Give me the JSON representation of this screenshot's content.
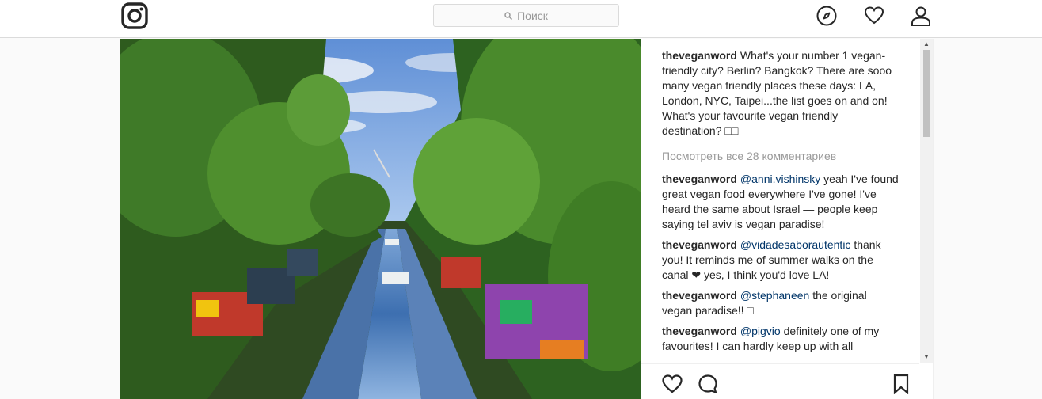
{
  "app": {
    "logo_icon": "instagram-logo-icon"
  },
  "search": {
    "placeholder": "Поиск",
    "icon": "search-icon"
  },
  "nav": {
    "explore_icon": "compass-icon",
    "activity_icon": "heart-icon",
    "profile_icon": "user-icon"
  },
  "post": {
    "image_description_icon": "canal-photo",
    "caption": {
      "user": "theveganword",
      "text": "What's your number 1 vegan-friendly city? Berlin? Bangkok? There are sooo many vegan friendly places these days: LA, London, NYC, Taipei...the list goes on and on! What's your favourite vegan friendly destination? □□"
    },
    "view_all": "Посмотреть все 28 комментариев",
    "comments": [
      {
        "user": "theveganword",
        "mention": "@anni.vishinsky",
        "text": "yeah I've found great vegan food everywhere I've gone! I've heard the same about Israel — people keep saying tel aviv is vegan paradise!"
      },
      {
        "user": "theveganword",
        "mention": "@vidadesaborautentic",
        "text": "thank you! It reminds me of summer walks on the canal ❤ yes, I think you'd love LA!"
      },
      {
        "user": "theveganword",
        "mention": "@stephaneen",
        "text": "the original vegan paradise!! □"
      },
      {
        "user": "theveganword",
        "mention": "@pigvio",
        "text": "definitely one of my favourites! I can hardly keep up with all"
      }
    ]
  },
  "actions": {
    "like_icon": "heart-icon",
    "comment_icon": "comment-icon",
    "save_icon": "bookmark-icon"
  },
  "colors": {
    "link": "#003569",
    "muted": "#999999",
    "border": "#dbdbdb"
  }
}
